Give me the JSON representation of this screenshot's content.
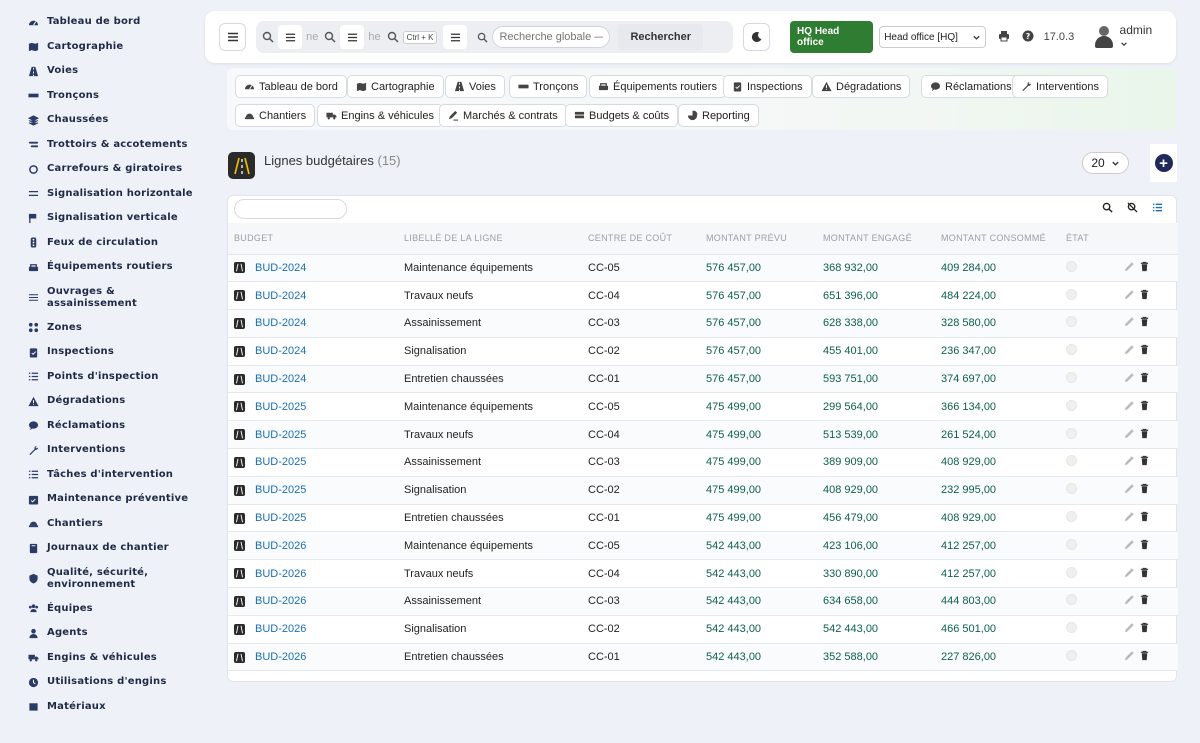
{
  "sidebar": {
    "items": [
      {
        "label": "Tableau de bord",
        "icon": "dashboard-icon"
      },
      {
        "label": "Cartographie",
        "icon": "map-icon"
      },
      {
        "label": "Voies",
        "icon": "road-icon"
      },
      {
        "label": "Tronçons",
        "icon": "segment-icon"
      },
      {
        "label": "Chaussées",
        "icon": "layers-icon"
      },
      {
        "label": "Trottoirs & accotements",
        "icon": "sidewalk-icon"
      },
      {
        "label": "Carrefours & giratoires",
        "icon": "roundabout-icon"
      },
      {
        "label": "Signalisation horizontale",
        "icon": "road-marking-icon"
      },
      {
        "label": "Signalisation verticale",
        "icon": "sign-icon"
      },
      {
        "label": "Feux de circulation",
        "icon": "traffic-light-icon"
      },
      {
        "label": "Équipements routiers",
        "icon": "equipment-icon"
      },
      {
        "label": "Ouvrages & assainissement",
        "icon": "drainage-icon"
      },
      {
        "label": "Zones",
        "icon": "zones-icon"
      },
      {
        "label": "Inspections",
        "icon": "clipboard-icon"
      },
      {
        "label": "Points d'inspection",
        "icon": "list-icon"
      },
      {
        "label": "Dégradations",
        "icon": "warning-icon"
      },
      {
        "label": "Réclamations",
        "icon": "comment-icon"
      },
      {
        "label": "Interventions",
        "icon": "wrench-icon"
      },
      {
        "label": "Tâches d'intervention",
        "icon": "tasks-icon"
      },
      {
        "label": "Maintenance préventive",
        "icon": "calendar-check-icon"
      },
      {
        "label": "Chantiers",
        "icon": "hardhat-icon"
      },
      {
        "label": "Journaux de chantier",
        "icon": "book-icon"
      },
      {
        "label": "Qualité, sécurité, environnement",
        "icon": "shield-icon"
      },
      {
        "label": "Équipes",
        "icon": "team-icon"
      },
      {
        "label": "Agents",
        "icon": "user-icon"
      },
      {
        "label": "Engins & véhicules",
        "icon": "truck-icon"
      },
      {
        "label": "Utilisations d'engins",
        "icon": "clock-icon"
      },
      {
        "label": "Matériaux",
        "icon": "box-icon"
      }
    ]
  },
  "header": {
    "search_fragment_1": "ne",
    "search_fragment_2": "he",
    "shortcut": "Ctrl + K",
    "global_search_placeholder": "Recherche globale — c",
    "search_button": "Rechercher",
    "hq_badge": "HQ Head office",
    "office_select": "Head office [HQ]",
    "version": "17.0.3",
    "user": "admin"
  },
  "nav_chips": [
    {
      "label": "Tableau de bord",
      "icon": "dashboard-icon"
    },
    {
      "label": "Cartographie",
      "icon": "map-icon"
    },
    {
      "label": "Voies",
      "icon": "road-icon"
    },
    {
      "label": "Tronçons",
      "icon": "segment-icon"
    },
    {
      "label": "Équipements routiers",
      "icon": "equipment-icon"
    },
    {
      "label": "Inspections",
      "icon": "clipboard-icon"
    },
    {
      "label": "Dégradations",
      "icon": "warning-icon"
    },
    {
      "label": "Réclamations",
      "icon": "comment-icon"
    },
    {
      "label": "Interventions",
      "icon": "wrench-icon"
    },
    {
      "label": "Chantiers",
      "icon": "hardhat-icon"
    },
    {
      "label": "Engins & véhicules",
      "icon": "truck-icon"
    },
    {
      "label": "Marchés & contrats",
      "icon": "contract-icon"
    },
    {
      "label": "Budgets & coûts",
      "icon": "money-icon"
    },
    {
      "label": "Reporting",
      "icon": "pie-chart-icon"
    }
  ],
  "page": {
    "title": "Lignes budgétaires",
    "count": "(15)",
    "page_size": "20"
  },
  "table": {
    "columns": [
      "BUDGET",
      "LIBELLÉ DE LA LIGNE",
      "CENTRE DE COÛT",
      "MONTANT PRÉVU",
      "MONTANT ENGAGÉ",
      "MONTANT CONSOMMÉ",
      "ÉTAT"
    ],
    "rows": [
      {
        "budget": "BUD-2024",
        "label": "Maintenance équipements",
        "cost_center": "CC-05",
        "planned": "576 457,00",
        "committed": "368 932,00",
        "consumed": "409 284,00"
      },
      {
        "budget": "BUD-2024",
        "label": "Travaux neufs",
        "cost_center": "CC-04",
        "planned": "576 457,00",
        "committed": "651 396,00",
        "consumed": "484 224,00"
      },
      {
        "budget": "BUD-2024",
        "label": "Assainissement",
        "cost_center": "CC-03",
        "planned": "576 457,00",
        "committed": "628 338,00",
        "consumed": "328 580,00"
      },
      {
        "budget": "BUD-2024",
        "label": "Signalisation",
        "cost_center": "CC-02",
        "planned": "576 457,00",
        "committed": "455 401,00",
        "consumed": "236 347,00"
      },
      {
        "budget": "BUD-2024",
        "label": "Entretien chaussées",
        "cost_center": "CC-01",
        "planned": "576 457,00",
        "committed": "593 751,00",
        "consumed": "374 697,00"
      },
      {
        "budget": "BUD-2025",
        "label": "Maintenance équipements",
        "cost_center": "CC-05",
        "planned": "475 499,00",
        "committed": "299 564,00",
        "consumed": "366 134,00"
      },
      {
        "budget": "BUD-2025",
        "label": "Travaux neufs",
        "cost_center": "CC-04",
        "planned": "475 499,00",
        "committed": "513 539,00",
        "consumed": "261 524,00"
      },
      {
        "budget": "BUD-2025",
        "label": "Assainissement",
        "cost_center": "CC-03",
        "planned": "475 499,00",
        "committed": "389 909,00",
        "consumed": "408 929,00"
      },
      {
        "budget": "BUD-2025",
        "label": "Signalisation",
        "cost_center": "CC-02",
        "planned": "475 499,00",
        "committed": "408 929,00",
        "consumed": "232 995,00"
      },
      {
        "budget": "BUD-2025",
        "label": "Entretien chaussées",
        "cost_center": "CC-01",
        "planned": "475 499,00",
        "committed": "456 479,00",
        "consumed": "408 929,00"
      },
      {
        "budget": "BUD-2026",
        "label": "Maintenance équipements",
        "cost_center": "CC-05",
        "planned": "542 443,00",
        "committed": "423 106,00",
        "consumed": "412 257,00"
      },
      {
        "budget": "BUD-2026",
        "label": "Travaux neufs",
        "cost_center": "CC-04",
        "planned": "542 443,00",
        "committed": "330 890,00",
        "consumed": "412 257,00"
      },
      {
        "budget": "BUD-2026",
        "label": "Assainissement",
        "cost_center": "CC-03",
        "planned": "542 443,00",
        "committed": "634 658,00",
        "consumed": "444 803,00"
      },
      {
        "budget": "BUD-2026",
        "label": "Signalisation",
        "cost_center": "CC-02",
        "planned": "542 443,00",
        "committed": "542 443,00",
        "consumed": "466 501,00"
      },
      {
        "budget": "BUD-2026",
        "label": "Entretien chaussées",
        "cost_center": "CC-01",
        "planned": "542 443,00",
        "committed": "352 588,00",
        "consumed": "227 826,00"
      }
    ]
  },
  "colors": {
    "accent": "#1a6fb5",
    "amount": "#0d5f4c",
    "hq_green": "#2f7d32",
    "add_button": "#1f2a5a"
  }
}
